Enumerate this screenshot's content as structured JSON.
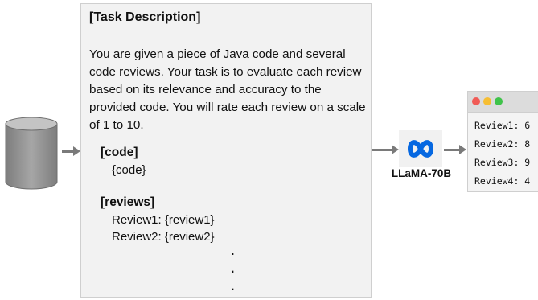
{
  "prompt": {
    "title": "[Task Description]",
    "description": "You are given a piece of Java code and several code reviews. Your task is to evaluate each review based on its relevance and accuracy to the provided code. You will rate each review on a scale of 1 to 10.",
    "code_header": "[code]",
    "code_placeholder": "{code}",
    "reviews_header": "[reviews]",
    "review_lines": [
      "Review1: {review1}",
      "Review2: {review2}"
    ],
    "continuation": "."
  },
  "model": {
    "label": "LLaMA-70B",
    "icon": "meta-infinity-icon"
  },
  "output": {
    "scores": [
      "Review1: 6",
      "Review2: 8",
      "Review3: 9",
      "Review4: 4"
    ],
    "traffic_lights": [
      "#f05b56",
      "#f6be33",
      "#3fc34a"
    ]
  },
  "colors": {
    "arrow": "#7a7a7a",
    "cylinder": "#8c8c8c",
    "logo": "#0668e1"
  }
}
